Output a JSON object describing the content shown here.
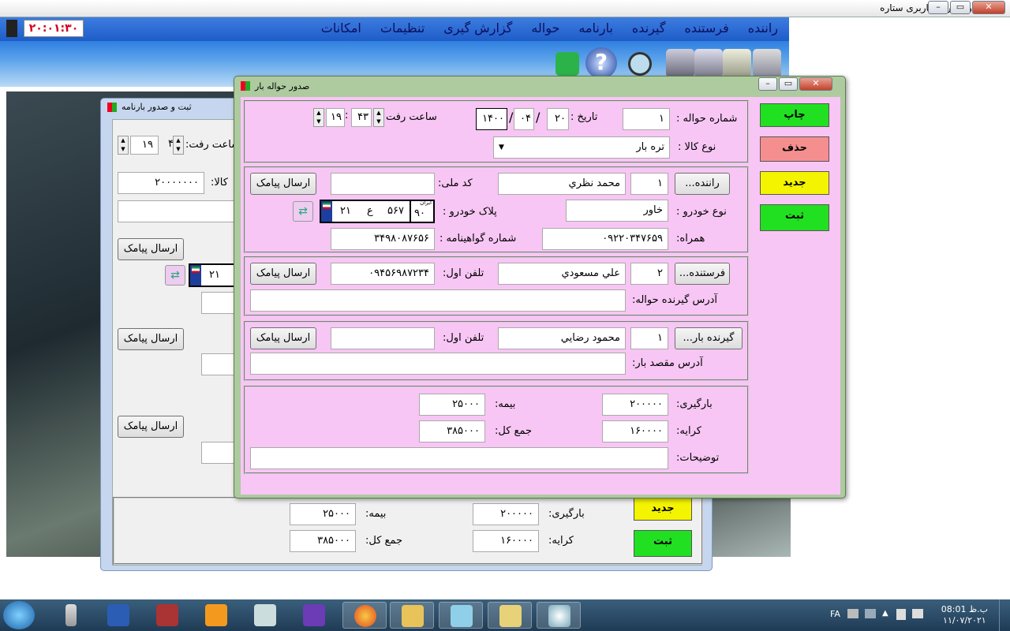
{
  "app": {
    "title": "نرم افزار مدیریت باربری ستاره",
    "clock": "۲۰:۰۱:۳۰",
    "menus": [
      "راننده",
      "فرستنده",
      "گیرنده",
      "بارنامه",
      "حواله",
      "گزارش گیری",
      "تنظیمات",
      "امکانات"
    ],
    "toolbar_icons": [
      "building-icon",
      "boxes-icon",
      "truck-icon",
      "warehouse-icon",
      "search-icon",
      "help-icon",
      "phone-icon"
    ]
  },
  "background_form": {
    "title": "ثبت و صدور بارنامه",
    "time_label": "ساعت رفت:",
    "hour": "۱۹",
    "minute": "۴۳",
    "goods_label": "کالا:",
    "goods_value": "۲۰۰۰۰۰۰۰",
    "sms_label": "ارسال پیامک",
    "plate_num": "۲۱",
    "loading_label": "بارگیری:",
    "loading_value": "۲۰۰۰۰۰",
    "insurance_label": "بیمه:",
    "insurance_value": "۲۵۰۰۰",
    "fare_label": "کرایه:",
    "fare_value": "۱۶۰۰۰۰",
    "total_label": "جمع کل:",
    "total_value": "۳۸۵۰۰۰",
    "new_label": "جدید",
    "save_label": "ثبت"
  },
  "dialog": {
    "title": "صدور حواله بار",
    "actions": {
      "print": "چاپ",
      "delete": "حذف",
      "new": "جدید",
      "save": "ثبت"
    },
    "colors": {
      "print": "#21e021",
      "delete": "#f58f8f",
      "new": "#f4f400",
      "save": "#21e021",
      "body": "#f7c6f4"
    },
    "header": {
      "number_label": "شماره حواله :",
      "number_value": "۱",
      "date_label": "تاریخ :",
      "day": "۲۰",
      "month": "۰۴",
      "year": "۱۴۰۰",
      "sep": "/",
      "time_label": "ساعت رفت",
      "hour": "۱۹",
      "minute": "۴۳",
      "colon": ":",
      "goods_type_label": "نوع کالا :",
      "goods_type_value": "تره بار"
    },
    "driver": {
      "button": "راننده...",
      "code": "۱",
      "name": "محمد نظري",
      "national_id_label": "کد ملی:",
      "national_id": "",
      "sms": "ارسال پیامک",
      "vehicle_type_label": "نوع خودرو :",
      "vehicle_type": "خاور",
      "plate_label": "پلاک خودرو :",
      "plate_iran": "ایران",
      "plate_region": "۹۰",
      "plate_three": "۵۶۷",
      "plate_letter": "ع",
      "plate_two": "۲۱",
      "mobile_label": "همراه:",
      "mobile": "۰۹۲۲۰۳۴۷۶۵۹",
      "license_label": "شماره گواهینامه :",
      "license": "۳۴۹۸۰۸۷۶۵۶"
    },
    "sender": {
      "button": "فرستنده...",
      "code": "۲",
      "name": "علي مسعودي",
      "phone_label": "تلفن اول:",
      "phone": "۰۹۴۵۶۹۸۷۲۳۴",
      "sms": "ارسال پیامک",
      "address_label": "آدرس گیرنده حواله:",
      "address": ""
    },
    "receiver": {
      "button": "گیرنده بار...",
      "code": "۱",
      "name": "محمود رضايي",
      "phone_label": "تلفن اول:",
      "phone": "",
      "sms": "ارسال پیامک",
      "address_label": "آدرس مقصد بار:",
      "address": ""
    },
    "costs": {
      "loading_label": "بارگیری:",
      "loading": "۲۰۰۰۰۰",
      "insurance_label": "بیمه:",
      "insurance": "۲۵۰۰۰",
      "fare_label": "کرایه:",
      "fare": "۱۶۰۰۰۰",
      "total_label": "جمع کل:",
      "total": "۳۸۵۰۰۰",
      "notes_label": "توضیحات:",
      "notes": ""
    }
  },
  "taskbar": {
    "lang": "FA",
    "time": "ب.ظ 08:01",
    "date": "۱۱/۰۷/۲۰۲۱",
    "apps": [
      "microphone-icon",
      "word-icon",
      "media-icon",
      "player-icon",
      "calculator-icon",
      "visual-studio-icon",
      "firefox-icon",
      "explorer-icon",
      "notepad-icon",
      "truck-app-icon",
      "paint-icon"
    ]
  }
}
